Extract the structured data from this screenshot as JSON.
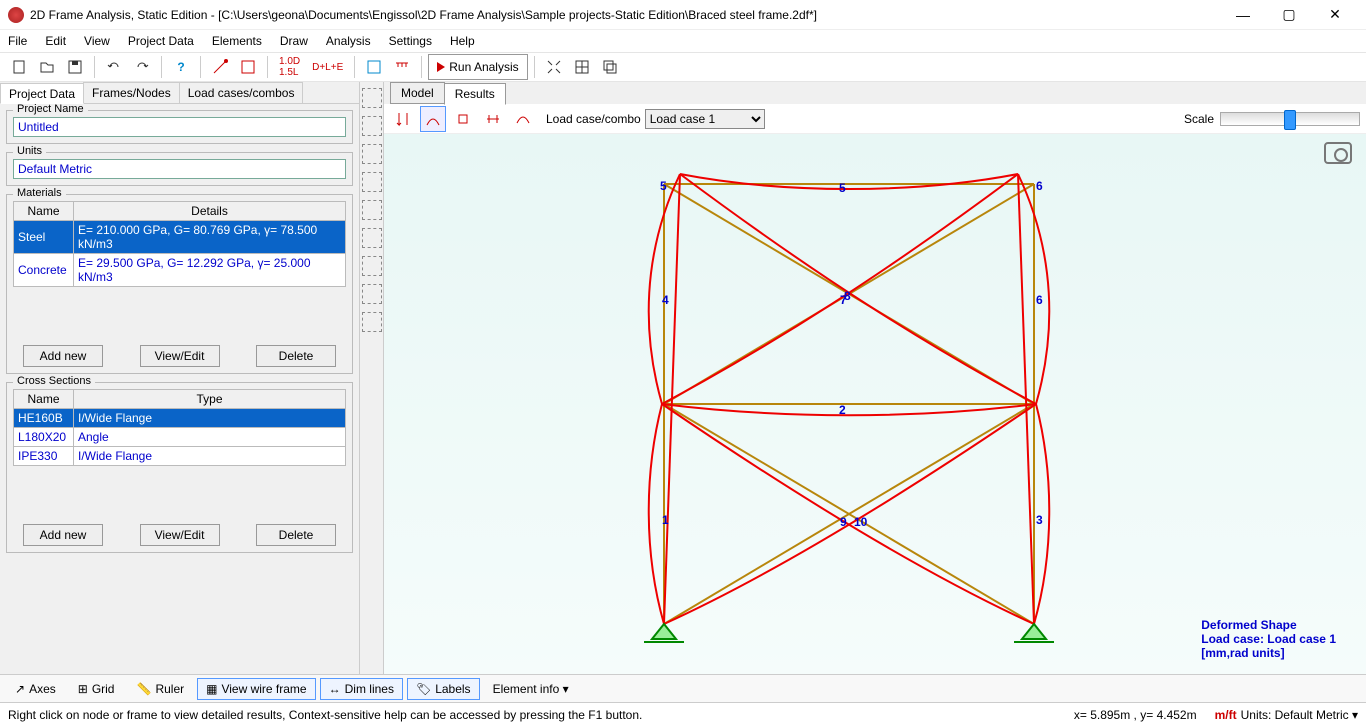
{
  "window": {
    "title": "2D Frame Analysis, Static Edition - [C:\\Users\\geona\\Documents\\Engissol\\2D Frame Analysis\\Sample projects-Static Edition\\Braced steel frame.2df*]"
  },
  "menu": {
    "file": "File",
    "edit": "Edit",
    "view": "View",
    "projectdata": "Project Data",
    "elements": "Elements",
    "draw": "Draw",
    "analysis": "Analysis",
    "settings": "Settings",
    "help": "Help"
  },
  "toolbar": {
    "run": "Run Analysis",
    "dle": "D+L+E",
    "dsl": "1.0D\n1.5L"
  },
  "sidebar": {
    "tabs": [
      "Project Data",
      "Frames/Nodes",
      "Load cases/combos"
    ],
    "projectname": {
      "label": "Project Name",
      "value": "Untitled"
    },
    "units": {
      "label": "Units",
      "value": "Default Metric"
    },
    "materials": {
      "label": "Materials",
      "cols": [
        "Name",
        "Details"
      ],
      "rows": [
        {
          "name": "Steel",
          "details": "E= 210.000 GPa, G= 80.769 GPa, γ= 78.500 kN/m3",
          "sel": true
        },
        {
          "name": "Concrete",
          "details": "E= 29.500 GPa, G= 12.292 GPa, γ= 25.000 kN/m3",
          "sel": false
        }
      ],
      "btns": [
        "Add new",
        "View/Edit",
        "Delete"
      ]
    },
    "sections": {
      "label": "Cross Sections",
      "cols": [
        "Name",
        "Type"
      ],
      "rows": [
        {
          "name": "HE160B",
          "type": "I/Wide Flange",
          "sel": true
        },
        {
          "name": "L180X20",
          "type": "Angle",
          "sel": false
        },
        {
          "name": "IPE330",
          "type": "I/Wide Flange",
          "sel": false
        }
      ],
      "btns": [
        "Add new",
        "View/Edit",
        "Delete"
      ]
    }
  },
  "viewtabs": [
    "Model",
    "Results"
  ],
  "viewtoolbar": {
    "loadlabel": "Load case/combo",
    "loadvalue": "Load case 1",
    "scalelabel": "Scale"
  },
  "legend": {
    "l1": "Deformed Shape",
    "l2": "Load case: Load case 1",
    "l3": "[mm,rad units]"
  },
  "bottombar": {
    "axes": "Axes",
    "grid": "Grid",
    "ruler": "Ruler",
    "wire": "View wire frame",
    "dim": "Dim lines",
    "labels": "Labels",
    "elinfo": "Element info ▾"
  },
  "statusbar": {
    "hint": "Right click on node or frame to view detailed results, Context-sensitive help can be accessed by pressing the F1 button.",
    "coords": "x= 5.895m , y= 4.452m",
    "unitprefix": "m/ft",
    "units": "Units: Default Metric ▾"
  },
  "elements": [
    "1",
    "2",
    "3",
    "4",
    "5",
    "6",
    "7",
    "8",
    "9",
    "10"
  ]
}
